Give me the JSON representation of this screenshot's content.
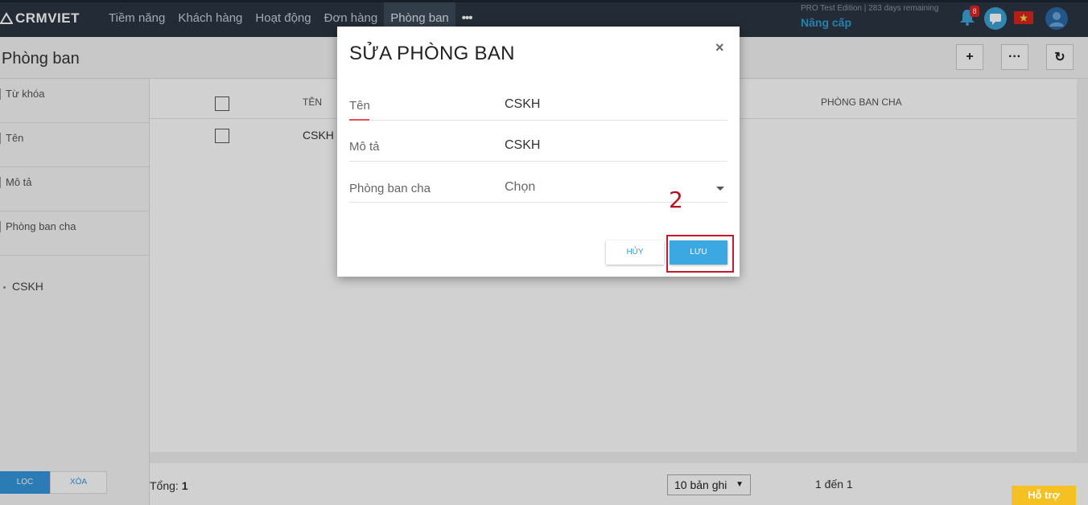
{
  "app": {
    "logo_text": "CRMVIET",
    "menu": [
      "Tiềm năng",
      "Khách hàng",
      "Hoạt động",
      "Đơn hàng",
      "Phòng ban"
    ],
    "menu_more": "•••",
    "edition": "PRO Test Edition | 283 days remaining",
    "upgrade": "Nâng cấp",
    "notification_count": "8"
  },
  "page": {
    "title": "Phòng ban",
    "actions": {
      "add": "+",
      "more": "···",
      "refresh": "↻"
    }
  },
  "filters": {
    "items": [
      "Từ khóa",
      "Tên",
      "Mô tả",
      "Phòng ban cha"
    ],
    "tree_node": "CSKH",
    "filter_button": "LỌC",
    "clear_button": "XÓA"
  },
  "table": {
    "columns": [
      "TÊN",
      "PHÒNG BAN CHA"
    ],
    "rows": [
      {
        "name": "CSKH",
        "parent": ""
      }
    ]
  },
  "footer": {
    "total_label": "Tổng:",
    "total_value": "1",
    "page_size": "10 bản ghi",
    "range": "1 đến 1",
    "support": "Hỗ trợ"
  },
  "modal": {
    "title": "SỬA PHÒNG BAN",
    "close": "×",
    "fields": [
      {
        "label": "Tên",
        "value": "CSKH"
      },
      {
        "label": "Mô tả",
        "value": "CSKH"
      },
      {
        "label": "Phòng ban cha",
        "value": "Chọn"
      }
    ],
    "cancel": "HỦY",
    "save": "LƯU"
  },
  "annotation": {
    "step": "2"
  },
  "colors": {
    "nav_bg": "#2b3643",
    "accent": "#3ca8e2",
    "highlight": "#c8182a",
    "support": "#f4c022"
  }
}
